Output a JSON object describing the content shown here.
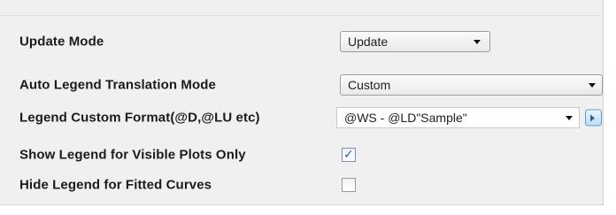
{
  "settings": {
    "rows": [
      {
        "label": "Update Mode",
        "control": "dropdown",
        "value": "Update"
      },
      {
        "label": "Auto Legend Translation Mode",
        "control": "dropdown",
        "value": "Custom"
      },
      {
        "label": "Legend Custom Format(@D,@LU etc)",
        "control": "editable-dropdown",
        "value": "@WS - @LD\"Sample\"",
        "button_icon": "chevron-right-icon"
      },
      {
        "label": "Show Legend for Visible Plots Only",
        "control": "checkbox",
        "checked": true,
        "check_glyph": "✓"
      },
      {
        "label": "Hide Legend for Fitted Curves",
        "control": "checkbox",
        "checked": false
      }
    ]
  }
}
